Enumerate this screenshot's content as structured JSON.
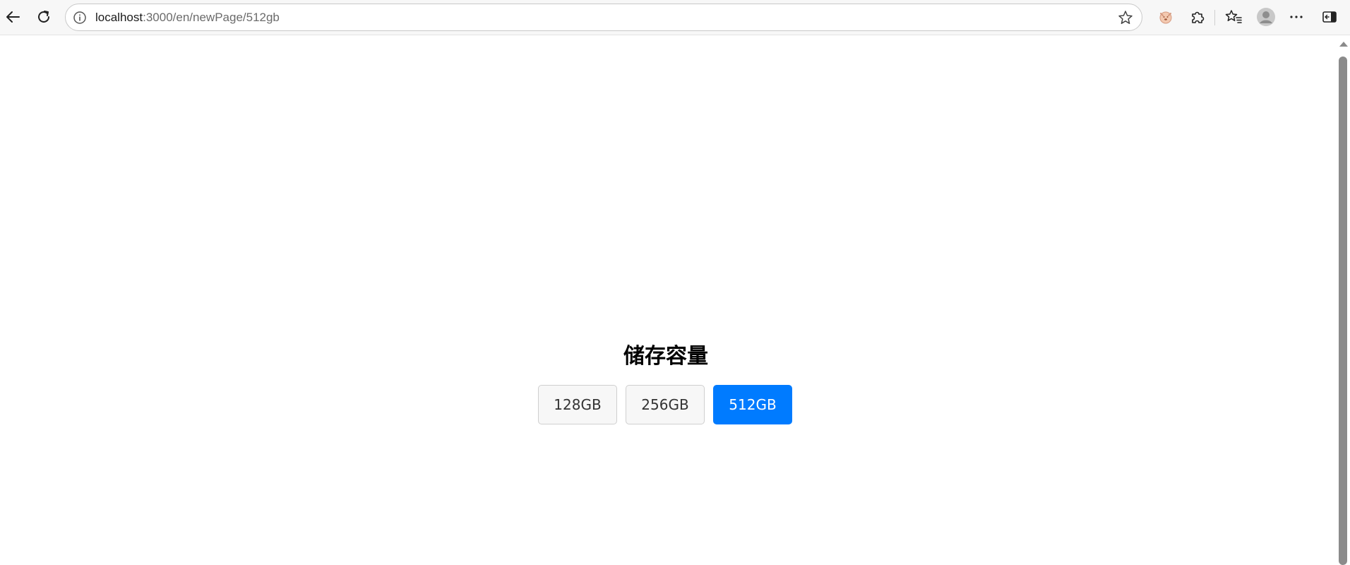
{
  "browser": {
    "url_host": "localhost",
    "url_path": ":3000/en/newPage/512gb",
    "icons": {
      "back": "back-arrow-icon",
      "reload": "reload-icon",
      "info": "info-icon",
      "favorite": "star-icon",
      "extension": "puzzle-icon",
      "favorites": "favorites-icon",
      "profile": "profile-avatar-icon",
      "menu": "more-dots-icon",
      "sidebar": "sidebar-toggle-icon"
    }
  },
  "page": {
    "title": "储存容量",
    "options": [
      {
        "label": "128GB",
        "selected": false
      },
      {
        "label": "256GB",
        "selected": false
      },
      {
        "label": "512GB",
        "selected": true
      }
    ],
    "accent_color": "#007bff"
  }
}
